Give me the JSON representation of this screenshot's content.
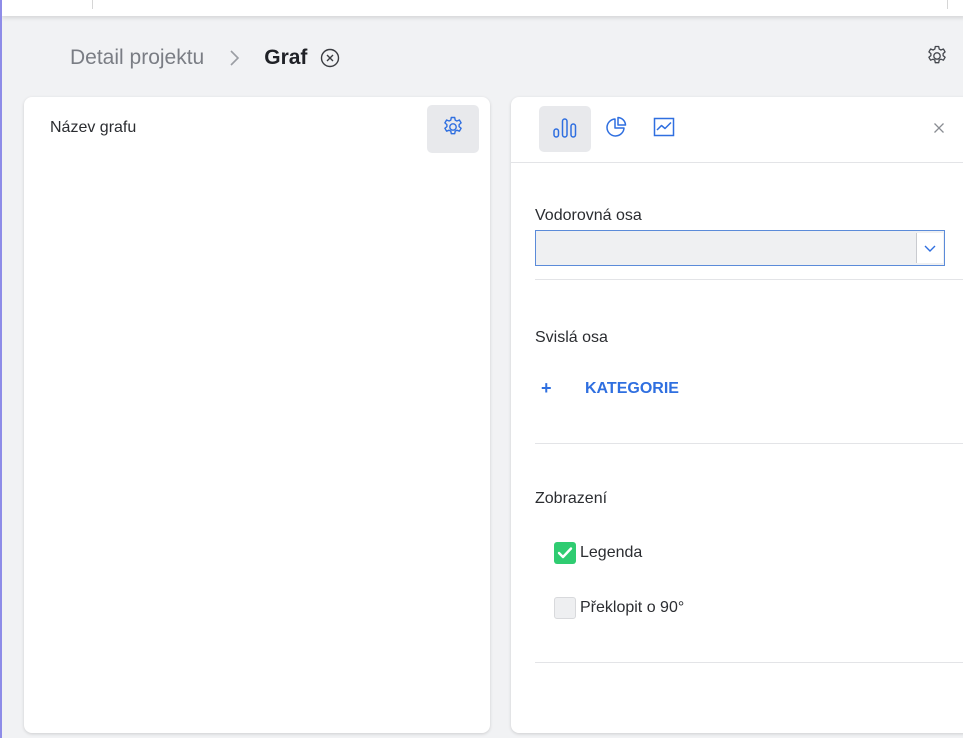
{
  "header": {
    "breadcrumb_parent": "Detail projektu",
    "breadcrumb_current": "Graf"
  },
  "chart_card": {
    "title": "Název grafu"
  },
  "config_panel": {
    "tabs": [
      {
        "icon": "bar-chart-icon",
        "active": true
      },
      {
        "icon": "pie-chart-icon",
        "active": false
      },
      {
        "icon": "line-chart-icon",
        "active": false
      }
    ],
    "horizontal_axis_label": "Vodorovná osa",
    "horizontal_axis_value": "",
    "vertical_axis_label": "Svislá osa",
    "add_category_plus": "+",
    "add_category_label": "KATEGORIE",
    "display_label": "Zobrazení",
    "options": [
      {
        "label": "Legenda",
        "checked": true
      },
      {
        "label": "Překlopit o 90°",
        "checked": false
      }
    ]
  },
  "colors": {
    "accent": "#2f6fe0",
    "checkbox_checked": "#2fcc71",
    "background": "#f1f2f4"
  }
}
